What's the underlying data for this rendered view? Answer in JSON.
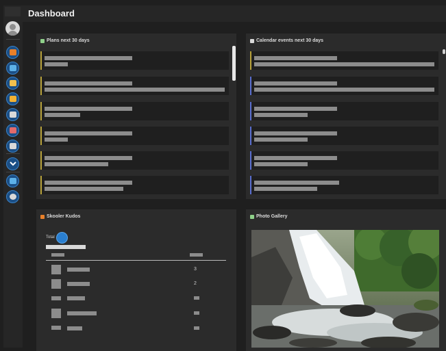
{
  "header": {
    "title": "Dashboard"
  },
  "sidebar": {
    "icons": [
      {
        "name": "home-icon",
        "color": "#e8802a"
      },
      {
        "name": "chat-icon",
        "color": "#5db1e8"
      },
      {
        "name": "notes-icon",
        "color": "#f2c14e"
      },
      {
        "name": "files-icon",
        "color": "#f2b233"
      },
      {
        "name": "document-icon",
        "color": "#d9d9d9"
      },
      {
        "name": "people-icon",
        "color": "#e36b6b"
      },
      {
        "name": "calendar-icon",
        "color": "#d9d9d9"
      },
      {
        "name": "chevron-down-icon",
        "color": "#ffffff"
      },
      {
        "name": "signout-icon",
        "color": "#5db1e8"
      },
      {
        "name": "settings-icon",
        "color": "#d9d9d9"
      }
    ]
  },
  "plans": {
    "title": "Plans next 30 days",
    "icon": "plans-icon",
    "accent": "#b8a23a"
  },
  "calendar": {
    "title": "Calendar events next 30 days",
    "icon": "calendar-events-icon",
    "accent_colors": [
      "#b8a23a",
      "#5a6fd0"
    ]
  },
  "kudos": {
    "title": "Skooler Kudos",
    "icon": "kudos-icon",
    "total_label": "Total",
    "rows": [
      {
        "value": "3"
      },
      {
        "value": "2"
      },
      {
        "value": ""
      },
      {
        "value": ""
      },
      {
        "value": ""
      }
    ]
  },
  "gallery": {
    "title": "Photo Gallery",
    "icon": "gallery-icon",
    "photo": "waterfall-photo"
  },
  "colors": {
    "background": "#1f1f1f",
    "panel": "#2b2b2b",
    "card": "#1f1f1f",
    "accent_blue": "#2a7fd0"
  }
}
